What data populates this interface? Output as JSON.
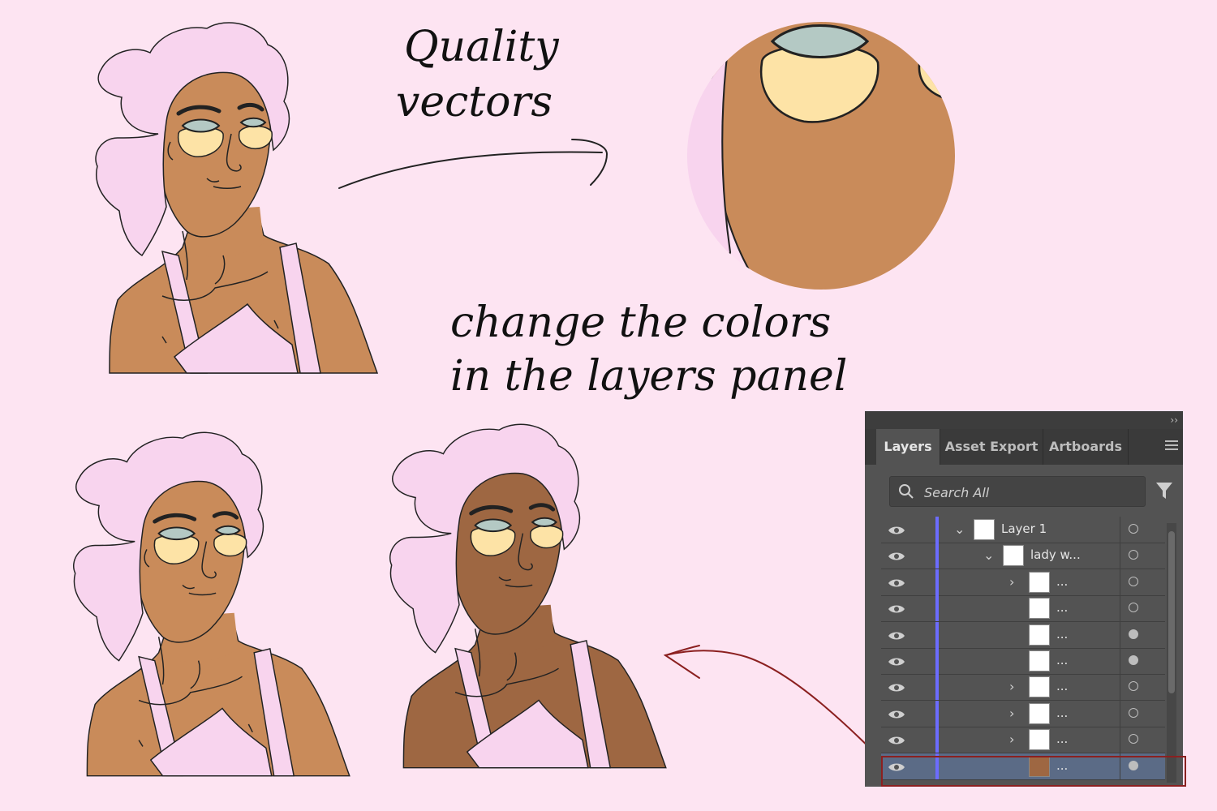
{
  "annotations": {
    "quality_line1": "Quality",
    "quality_line2": "vectors",
    "change_line1": "change the colors",
    "change_line2": "in the layers panel"
  },
  "colors": {
    "background": "#fde4f2",
    "towel": "#f8d4ee",
    "skin_original": "#c98b5a",
    "skin_dark": "#9e6742",
    "eye_patch": "#fde3a6",
    "eye": "#b4c9c4",
    "arrow_red": "#8b2020"
  },
  "layers_panel": {
    "tabs": [
      {
        "label": "Layers",
        "active": true
      },
      {
        "label": "Asset Export",
        "active": false
      },
      {
        "label": "Artboards",
        "active": false
      }
    ],
    "search_placeholder": "Search All",
    "rows": [
      {
        "name": "Layer 1",
        "expanded": true,
        "indent": 0,
        "target_filled": false,
        "selected": false
      },
      {
        "name": "lady w...",
        "expanded": true,
        "indent": 1,
        "target_filled": false,
        "selected": false
      },
      {
        "name": "...",
        "expanded": false,
        "has_children": true,
        "indent": 2,
        "target_filled": false,
        "selected": false
      },
      {
        "name": "...",
        "has_children": false,
        "indent": 2,
        "target_filled": false,
        "selected": false
      },
      {
        "name": "...",
        "has_children": false,
        "indent": 2,
        "target_filled": true,
        "selected": false
      },
      {
        "name": "...",
        "has_children": false,
        "indent": 2,
        "target_filled": true,
        "selected": false
      },
      {
        "name": "...",
        "expanded": false,
        "has_children": true,
        "indent": 2,
        "target_filled": false,
        "selected": false
      },
      {
        "name": "...",
        "expanded": false,
        "has_children": true,
        "indent": 2,
        "target_filled": false,
        "selected": false
      },
      {
        "name": "...",
        "expanded": false,
        "has_children": true,
        "indent": 2,
        "target_filled": false,
        "selected": false
      },
      {
        "name": "...",
        "has_children": false,
        "indent": 2,
        "target_filled": true,
        "selected": true
      }
    ]
  }
}
